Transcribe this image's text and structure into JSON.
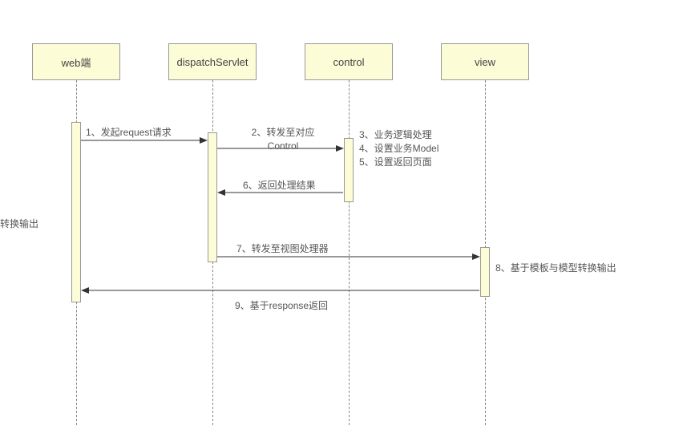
{
  "participants": {
    "web": "web端",
    "dispatch": "dispatchServlet",
    "control": "control",
    "view": "view"
  },
  "messages": {
    "m1": "1、发起request请求",
    "m2a": "2、转发至对应",
    "m2b": "Control",
    "m3a": "3、业务逻辑处理",
    "m3b": "4、设置业务Model",
    "m3c": "5、设置返回页面",
    "m6": "6、返回处理结果",
    "m7": "7、转发至视图处理器",
    "m8": "8、基于模板与模型转换输出",
    "m9": "9、基于response返回"
  },
  "sideLabel": "转换输出"
}
